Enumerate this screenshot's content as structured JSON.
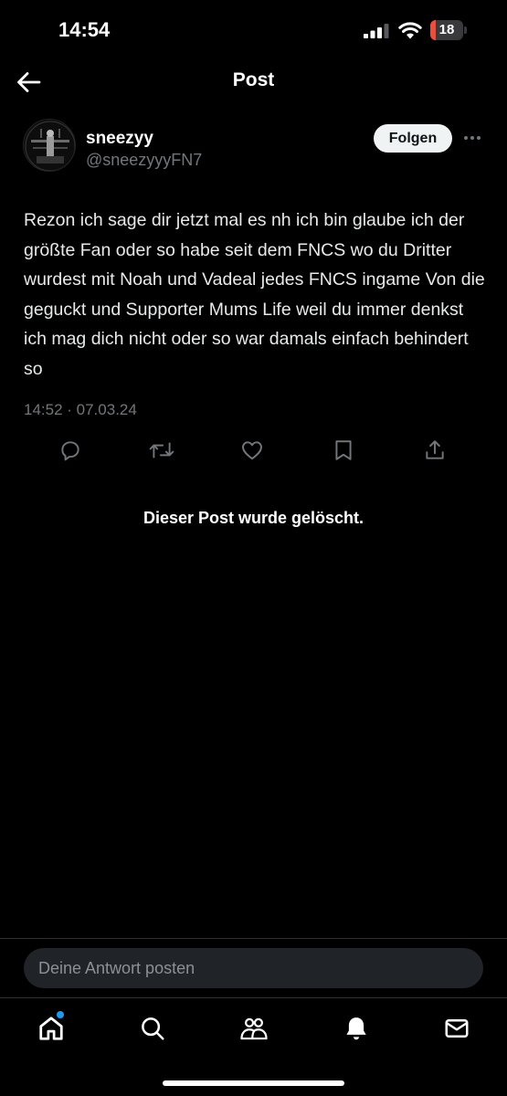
{
  "status_bar": {
    "time": "14:54",
    "battery_level": "18",
    "battery_fraction": 0.18,
    "battery_color": "#eb4e3d"
  },
  "header": {
    "title": "Post"
  },
  "post": {
    "author_name": "sneezyy",
    "author_handle": "@sneezyyyFN7",
    "follow_label": "Folgen",
    "text": "Rezon ich sage dir jetzt mal es nh ich bin glaube ich der größte Fan oder so habe seit dem FNCS wo du Dritter wurdest mit Noah und Vadeal jedes FNCS ingame Von die geguckt und Supporter Mums Life weil du immer denkst ich mag dich nicht oder so war damals einfach behindert so",
    "timestamp": "14:52 · 07.03.24",
    "actions": [
      "reply-icon",
      "repost-icon",
      "like-icon",
      "bookmark-icon",
      "share-icon"
    ]
  },
  "deleted_notice": "Dieser Post wurde gelöscht.",
  "reply": {
    "placeholder": "Deine Antwort posten"
  },
  "tab_bar": {
    "tabs": [
      "home-icon",
      "search-icon",
      "communities-icon",
      "notifications-icon",
      "messages-icon"
    ],
    "active": "home-icon",
    "accent_color": "#1d9bf0"
  }
}
